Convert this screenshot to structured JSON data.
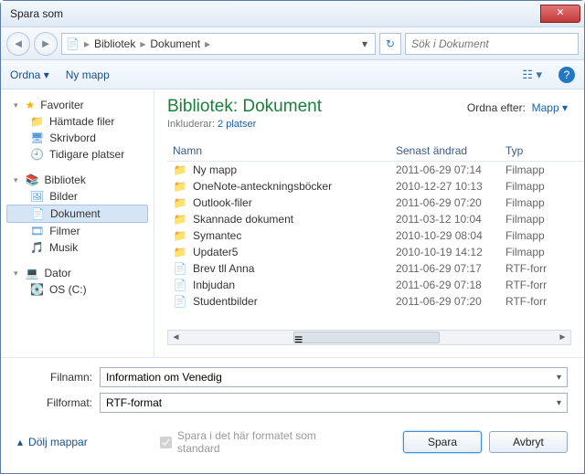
{
  "title": "Spara som",
  "breadcrumb": {
    "part1": "Bibliotek",
    "part2": "Dokument"
  },
  "search": {
    "placeholder": "Sök i Dokument"
  },
  "toolbar": {
    "organize": "Ordna",
    "newfolder": "Ny mapp"
  },
  "sidebar": {
    "fav": "Favoriter",
    "fav_items": [
      "Hämtade filer",
      "Skrivbord",
      "Tidigare platser"
    ],
    "lib": "Bibliotek",
    "lib_items": [
      "Bilder",
      "Dokument",
      "Filmer",
      "Musik"
    ],
    "computer": "Dator",
    "drive": "OS (C:)"
  },
  "content": {
    "heading_prefix": "Bibliotek:",
    "heading_main": "Dokument",
    "includes_label": "Inkluderar:",
    "includes_link": "2 platser",
    "sort_label": "Ordna efter:",
    "sort_value": "Mapp",
    "cols": {
      "name": "Namn",
      "modified": "Senast ändrad",
      "type": "Typ"
    },
    "rows": [
      {
        "icon": "folder",
        "name": "Ny mapp",
        "mod": "2011-06-29 07:14",
        "type": "Filmapp"
      },
      {
        "icon": "folder",
        "name": "OneNote-anteckningsböcker",
        "mod": "2010-12-27 10:13",
        "type": "Filmapp"
      },
      {
        "icon": "folder",
        "name": "Outlook-filer",
        "mod": "2011-06-29 07:20",
        "type": "Filmapp"
      },
      {
        "icon": "folder",
        "name": "Skannade dokument",
        "mod": "2011-03-12 10:04",
        "type": "Filmapp"
      },
      {
        "icon": "folder",
        "name": "Symantec",
        "mod": "2010-10-29 08:04",
        "type": "Filmapp"
      },
      {
        "icon": "folder",
        "name": "Updater5",
        "mod": "2010-10-19 14:12",
        "type": "Filmapp"
      },
      {
        "icon": "doc",
        "name": "Brev tll Anna",
        "mod": "2011-06-29 07:17",
        "type": "RTF-forr"
      },
      {
        "icon": "doc",
        "name": "Inbjudan",
        "mod": "2011-06-29 07:18",
        "type": "RTF-forr"
      },
      {
        "icon": "doc",
        "name": "Studentbilder",
        "mod": "2011-06-29 07:20",
        "type": "RTF-forr"
      }
    ]
  },
  "form": {
    "filename_label": "Filnamn:",
    "filename_value": "Information om Venedig",
    "format_label": "Filformat:",
    "format_value": "RTF-format"
  },
  "footer": {
    "hide": "Dölj mappar",
    "checkbox": "Spara i det här formatet som standard",
    "save": "Spara",
    "cancel": "Avbryt"
  }
}
